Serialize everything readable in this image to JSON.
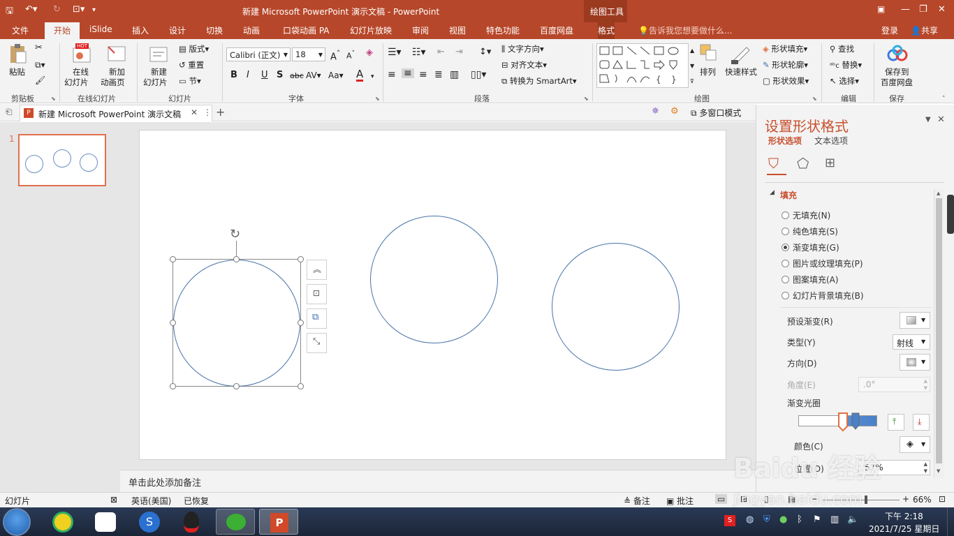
{
  "window": {
    "title": "新建 Microsoft PowerPoint 演示文稿 - PowerPoint",
    "contextual_tab_group": "绘图工具"
  },
  "tabs": [
    "文件",
    "开始",
    "iSlide",
    "插入",
    "设计",
    "切换",
    "动画",
    "口袋动画 PA",
    "幻灯片放映",
    "审阅",
    "视图",
    "特色功能",
    "百度网盘",
    "格式"
  ],
  "tell_me": "告诉我您想要做什么...",
  "account": {
    "login": "登录",
    "share": "共享"
  },
  "ribbon": {
    "clipboard": {
      "paste": "粘贴",
      "label": "剪贴板"
    },
    "online": {
      "btn1": "在线\n幻灯片",
      "btn1a": "在线",
      "btn1b": "幻灯片",
      "hot": "HOT",
      "btn2a": "新加",
      "btn2b": "动画页",
      "label": "在线幻灯片"
    },
    "slides": {
      "new_a": "新建",
      "new_b": "幻灯片",
      "layout": "版式",
      "reset": "重置",
      "section": "节",
      "label": "幻灯片"
    },
    "font": {
      "name": "Calibri (正文)",
      "size": "18",
      "label": "字体"
    },
    "paragraph": {
      "text_dir": "文字方向",
      "align_text": "对齐文本",
      "smartart": "转换为 SmartArt",
      "label": "段落"
    },
    "drawing": {
      "arrange": "排列",
      "quick_styles": "快速样式",
      "fill": "形状填充",
      "outline": "形状轮廓",
      "effects": "形状效果",
      "label": "绘图"
    },
    "editing": {
      "find": "查找",
      "replace": "替换",
      "select": "选择",
      "label": "编辑"
    },
    "save": {
      "a": "保存到",
      "b": "百度网盘",
      "label": "保存"
    }
  },
  "doc_tab": {
    "name": "新建 Microsoft PowerPoint 演示文稿",
    "multiwindow": "多窗口模式"
  },
  "slide_number": "1",
  "notes_placeholder": "单击此处添加备注",
  "format_pane": {
    "title": "设置形状格式",
    "tab_shape": "形状选项",
    "tab_text": "文本选项",
    "section": "填充",
    "fill_options": [
      {
        "label": "无填充(N)",
        "selected": false
      },
      {
        "label": "纯色填充(S)",
        "selected": false
      },
      {
        "label": "渐变填充(G)",
        "selected": true
      },
      {
        "label": "图片或纹理填充(P)",
        "selected": false
      },
      {
        "label": "图案填充(A)",
        "selected": false
      },
      {
        "label": "幻灯片背景填充(B)",
        "selected": false
      }
    ],
    "preset": "预设渐变(R)",
    "type_label": "类型(Y)",
    "type_value": "射线",
    "direction": "方向(D)",
    "angle": "角度(E)",
    "angle_value": ".0°",
    "stops": "渐变光圈",
    "color": "颜色(C)",
    "position": "位置(O)",
    "position_value": "57%"
  },
  "status": {
    "slide": "幻灯片",
    "lang": "英语(美国)",
    "recovered": "已恢复",
    "notes": "备注",
    "comments": "批注",
    "zoom": "66%"
  },
  "taskbar": {
    "time": "下午 2:18",
    "date": "2021/7/25 星期日"
  },
  "watermark": {
    "brand": "Baidu 经验",
    "url": "jingyan.baidu.com"
  },
  "colors": {
    "accent": "#b7472a",
    "shape_outline": "#4a74a8"
  }
}
